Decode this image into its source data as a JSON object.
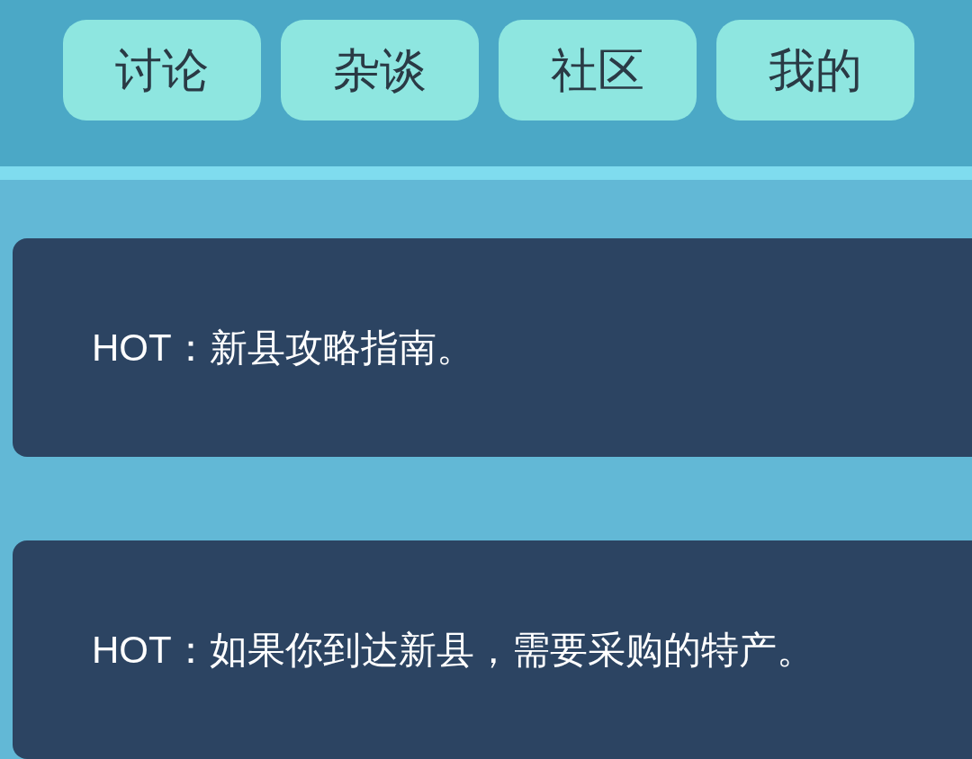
{
  "tabs": [
    {
      "label": "讨论"
    },
    {
      "label": "杂谈"
    },
    {
      "label": "社区"
    },
    {
      "label": "我的"
    }
  ],
  "posts": [
    {
      "text": "HOT：新县攻略指南。"
    },
    {
      "text": "HOT：如果你到达新县，需要采购的特产。"
    }
  ]
}
